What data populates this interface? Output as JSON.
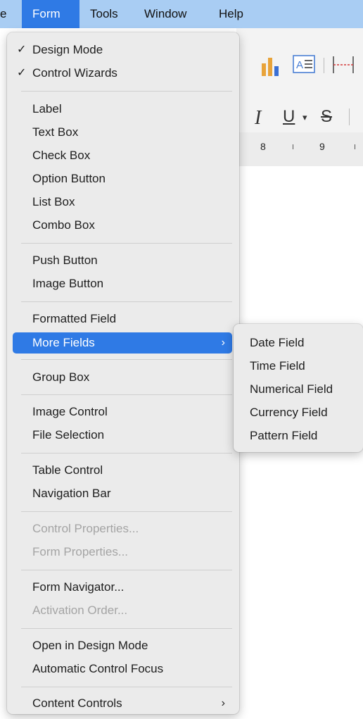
{
  "menubar": {
    "items": [
      {
        "label": "e"
      },
      {
        "label": "Form"
      },
      {
        "label": "Tools"
      },
      {
        "label": "Window"
      },
      {
        "label": "Help"
      }
    ],
    "active": "Form"
  },
  "toolbar": {
    "row2": {
      "italic": "I",
      "underline": "U",
      "strikethrough": "S"
    }
  },
  "ruler": {
    "numbers": [
      "8",
      "9"
    ]
  },
  "form_menu": {
    "items": [
      {
        "label": "Design Mode",
        "checked": true
      },
      {
        "label": "Control Wizards",
        "checked": true
      },
      {
        "label": "Label"
      },
      {
        "label": "Text Box"
      },
      {
        "label": "Check Box"
      },
      {
        "label": "Option Button"
      },
      {
        "label": "List Box"
      },
      {
        "label": "Combo Box"
      },
      {
        "label": "Push Button"
      },
      {
        "label": "Image Button"
      },
      {
        "label": "Formatted Field"
      },
      {
        "label": "More Fields",
        "submenu": true,
        "selected": true
      },
      {
        "label": "Group Box"
      },
      {
        "label": "Image Control"
      },
      {
        "label": "File Selection"
      },
      {
        "label": "Table Control"
      },
      {
        "label": "Navigation Bar"
      },
      {
        "label": "Control Properties...",
        "disabled": true
      },
      {
        "label": "Form Properties...",
        "disabled": true
      },
      {
        "label": "Form Navigator..."
      },
      {
        "label": "Activation Order...",
        "disabled": true
      },
      {
        "label": "Open in Design Mode"
      },
      {
        "label": "Automatic Control Focus"
      },
      {
        "label": "Content Controls",
        "submenu": true
      }
    ],
    "checkmark": "✓",
    "arrow": "›"
  },
  "more_fields_submenu": {
    "items": [
      {
        "label": "Date Field"
      },
      {
        "label": "Time Field"
      },
      {
        "label": "Numerical Field"
      },
      {
        "label": "Currency Field"
      },
      {
        "label": "Pattern Field"
      }
    ]
  },
  "colors": {
    "menubar_bg": "#a9cdf3",
    "accent": "#2f7ae5",
    "menu_bg": "#ebebeb",
    "disabled_text": "#a4a4a4"
  }
}
